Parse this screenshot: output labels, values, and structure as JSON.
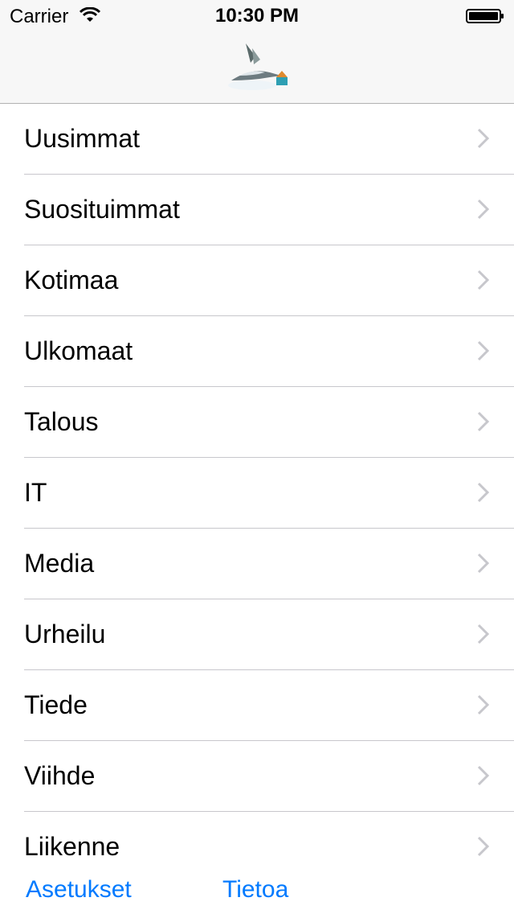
{
  "status_bar": {
    "carrier": "Carrier",
    "time": "10:30 PM",
    "wifi_icon": "wifi-icon",
    "battery_icon": "battery-full-icon"
  },
  "nav_bar": {
    "logo_icon": "stork-logo-icon"
  },
  "categories": [
    {
      "label": "Uusimmat"
    },
    {
      "label": "Suosituimmat"
    },
    {
      "label": "Kotimaa"
    },
    {
      "label": "Ulkomaat"
    },
    {
      "label": "Talous"
    },
    {
      "label": "IT"
    },
    {
      "label": "Media"
    },
    {
      "label": "Urheilu"
    },
    {
      "label": "Tiede"
    },
    {
      "label": "Viihde"
    },
    {
      "label": "Liikenne"
    }
  ],
  "toolbar": {
    "settings_label": "Asetukset",
    "info_label": "Tietoa"
  },
  "colors": {
    "accent": "#007aff",
    "chevron": "#c7c7cc",
    "separator": "#c8c7cc",
    "bar_background": "#f7f7f7"
  }
}
